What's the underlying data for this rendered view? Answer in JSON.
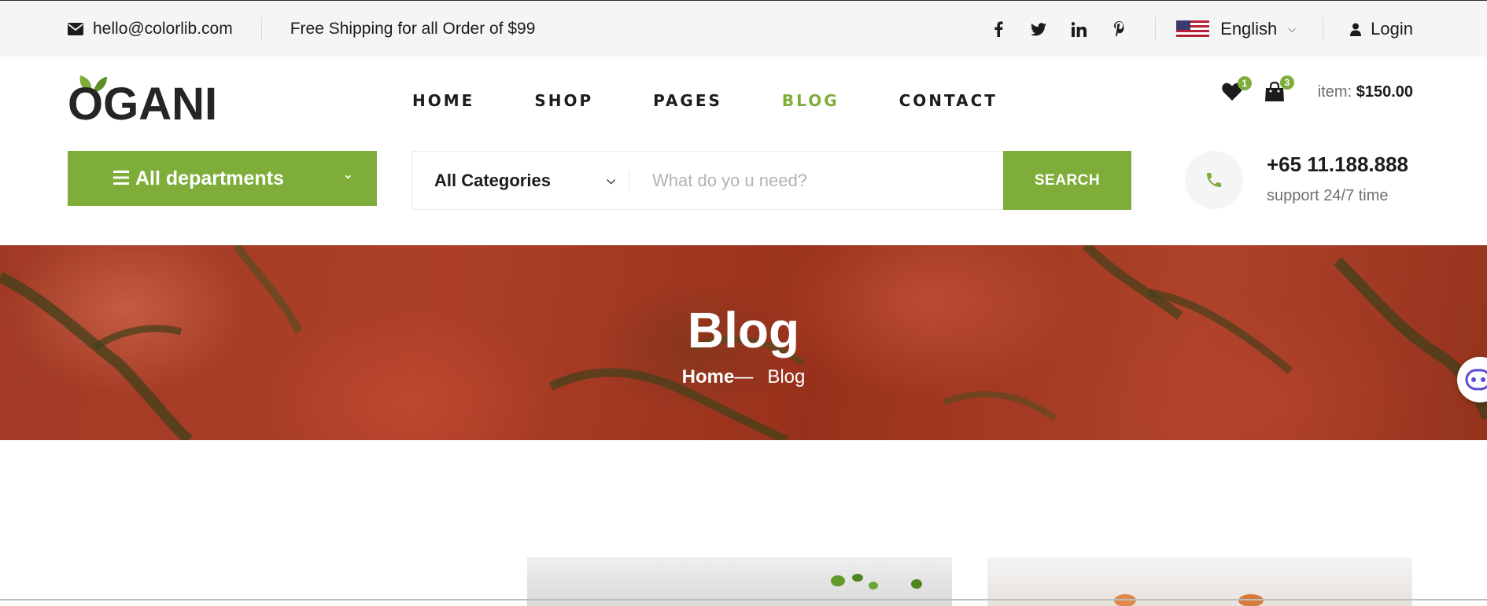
{
  "topbar": {
    "email": "hello@colorlib.com",
    "shipping": "Free Shipping for all Order of $99",
    "social": [
      {
        "name": "facebook",
        "glyph": "f"
      },
      {
        "name": "twitter",
        "glyph": "t"
      },
      {
        "name": "linkedin",
        "glyph": "in"
      },
      {
        "name": "pinterest",
        "glyph": "p"
      }
    ],
    "language": "English",
    "login": "Login"
  },
  "header": {
    "logo": "OGANI",
    "nav": [
      "HOME",
      "SHOP",
      "PAGES",
      "BLOG",
      "CONTACT"
    ],
    "active_nav": "BLOG",
    "wishlist_count": "1",
    "cart_count": "3",
    "item_label": "item:",
    "item_total": "$150.00"
  },
  "search": {
    "departments": "All departments",
    "category": "All Categories",
    "placeholder": "What do yo u need?",
    "button": "SEARCH",
    "phone": "+65 11.188.888",
    "support": "support 24/7 time"
  },
  "hero": {
    "title": "Blog",
    "crumb_home": "Home",
    "crumb_sep": "—",
    "crumb_current": "Blog"
  },
  "colors": {
    "accent": "#7fad39",
    "text": "#1c1c1c",
    "topbar_bg": "#f5f5f5"
  }
}
